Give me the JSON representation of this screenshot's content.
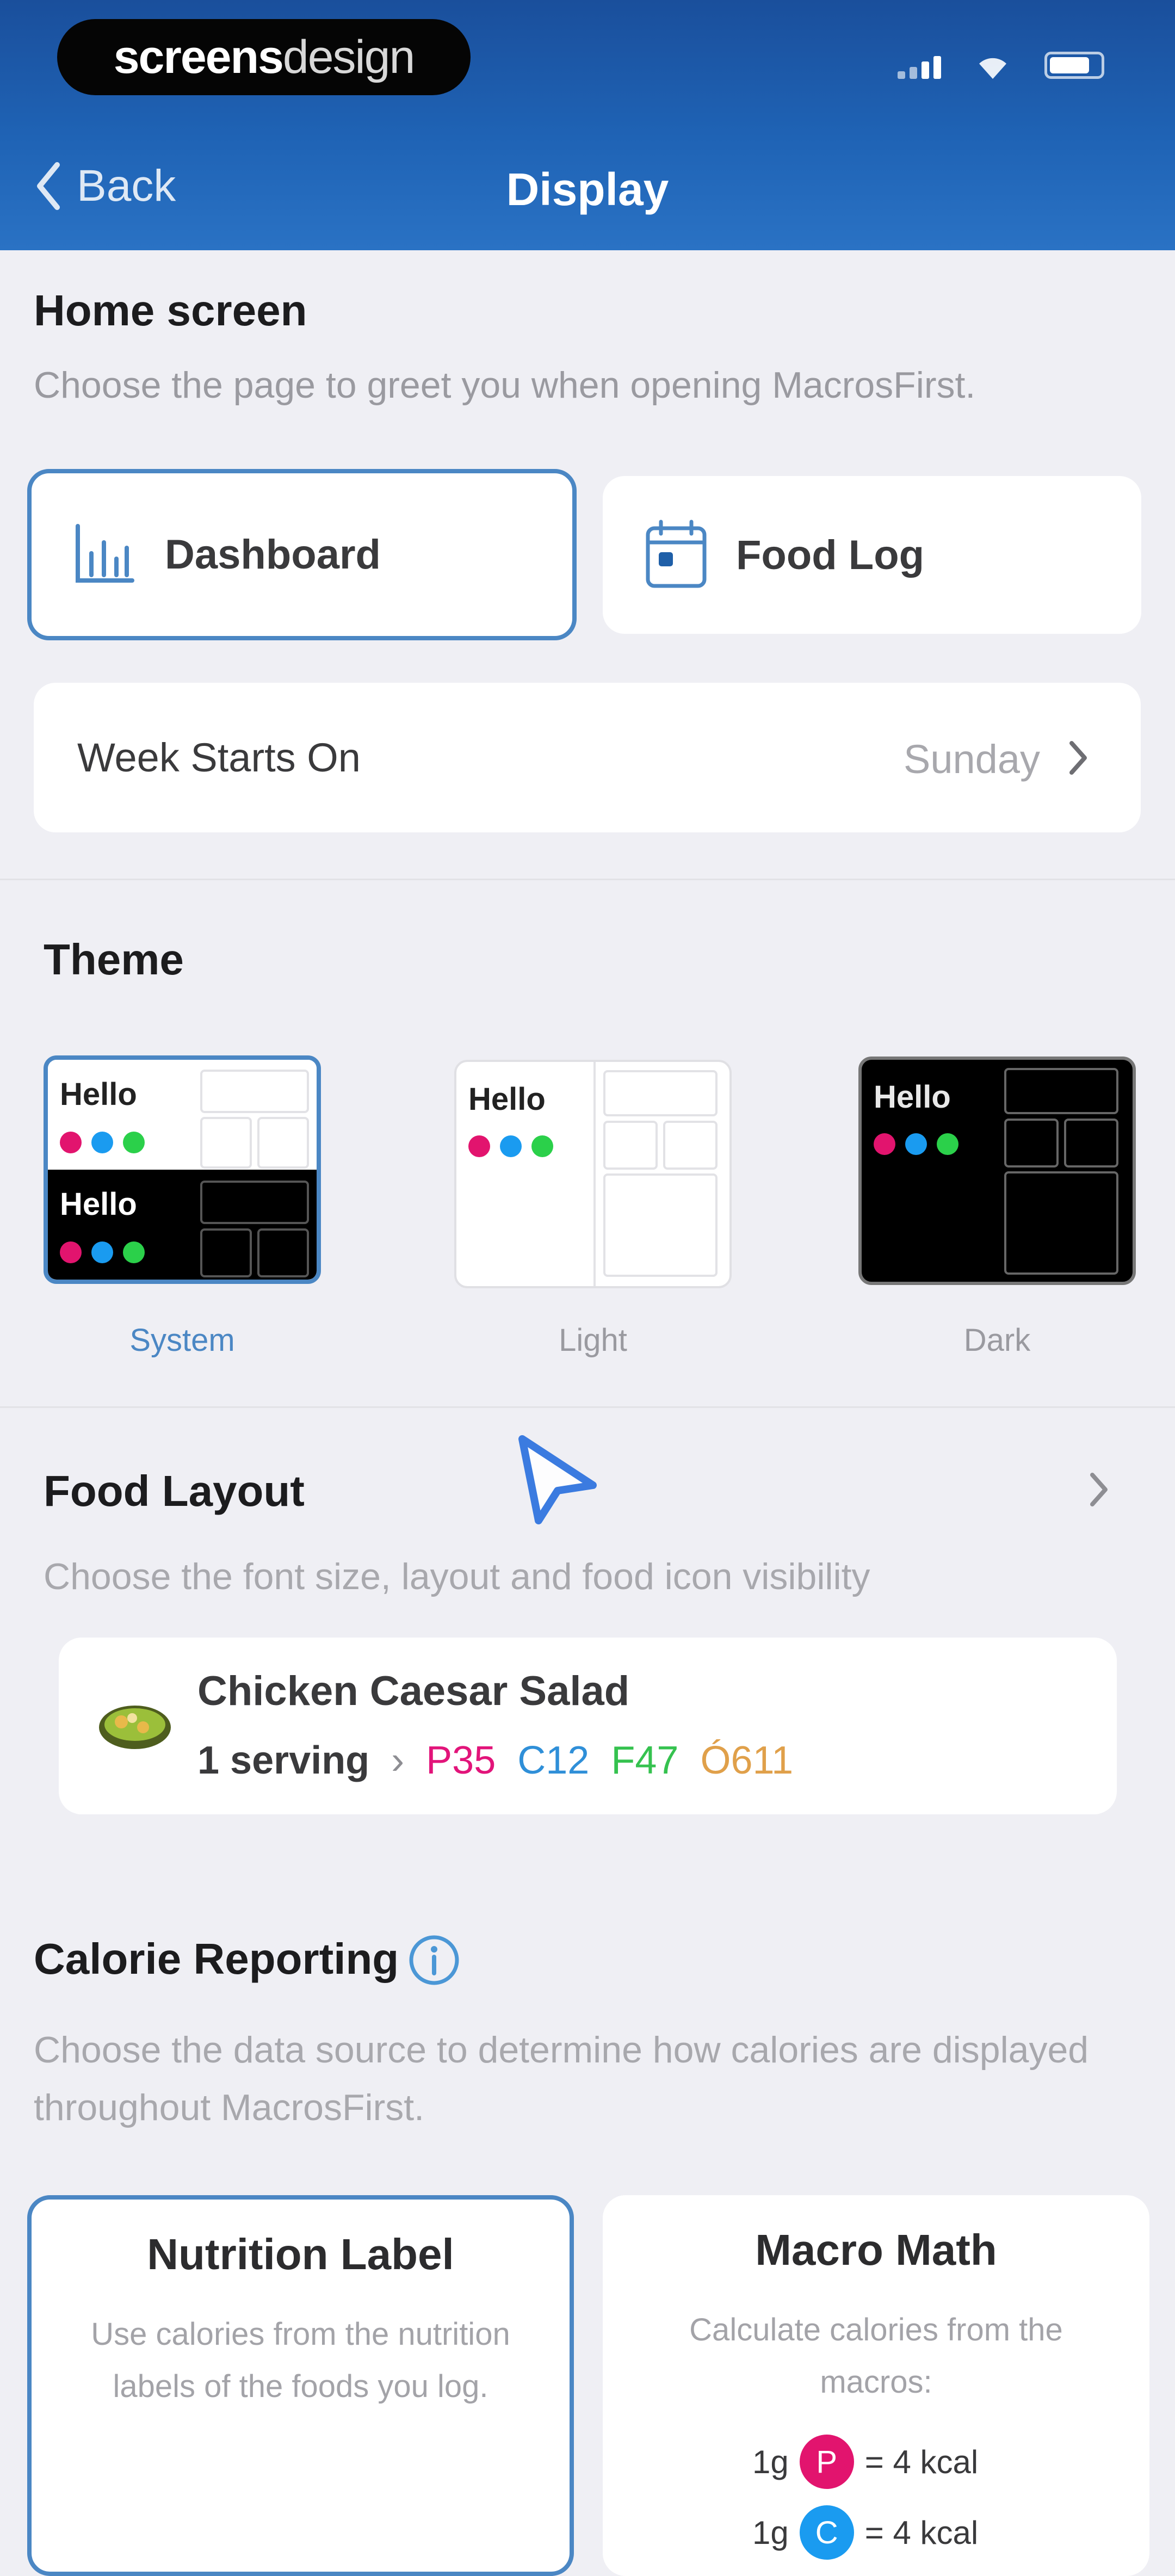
{
  "status_bar": {
    "brand_bold": "screens",
    "brand_light": "design"
  },
  "nav": {
    "back_label": "Back",
    "title": "Display"
  },
  "home_screen": {
    "title": "Home screen",
    "description": "Choose the page to greet you when opening MacrosFirst.",
    "options": [
      {
        "label": "Dashboard",
        "icon": "bar-chart-icon",
        "selected": true
      },
      {
        "label": "Food Log",
        "icon": "calendar-icon",
        "selected": false
      }
    ],
    "week_starts": {
      "label": "Week Starts On",
      "value": "Sunday"
    }
  },
  "theme": {
    "title": "Theme",
    "preview_text": "Hello",
    "options": [
      {
        "label": "System",
        "selected": true
      },
      {
        "label": "Light",
        "selected": false
      },
      {
        "label": "Dark",
        "selected": false
      }
    ],
    "dot_colors": [
      "#e2146e",
      "#1a9bf0",
      "#2bd04a"
    ],
    "accent": "#4b87c4"
  },
  "food_layout": {
    "title": "Food Layout",
    "description": "Choose the font size, layout and food icon visibility",
    "sample": {
      "name": "Chicken Caesar Salad",
      "serving": "1 serving",
      "separator": "›",
      "p": "P35",
      "c": "C12",
      "f": "F47",
      "cal": "Ó611"
    }
  },
  "calorie_reporting": {
    "title": "Calorie Reporting",
    "description": "Choose the data source to determine how calories are displayed throughout MacrosFirst.",
    "options": [
      {
        "title": "Nutrition Label",
        "description": "Use calories from the nutrition labels of the foods you log.",
        "selected": true
      },
      {
        "title": "Macro Math",
        "description": "Calculate calories from the macros:",
        "selected": false,
        "rows": [
          {
            "qty": "1g",
            "macro": "P",
            "eq": "= 4 kcal",
            "color": "#e2146e"
          },
          {
            "qty": "1g",
            "macro": "C",
            "eq": "= 4 kcal",
            "color": "#1a9bf0"
          }
        ]
      }
    ]
  }
}
